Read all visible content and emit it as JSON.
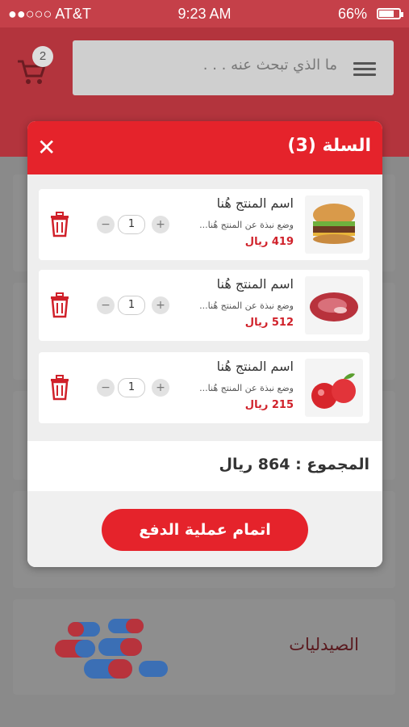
{
  "status_bar": {
    "carrier": "●●○○○ AT&T",
    "time": "9:23 AM",
    "battery": "66%"
  },
  "search": {
    "placeholder": "ما الذي تبحث عنه . . ."
  },
  "cart": {
    "count": "2"
  },
  "modal": {
    "title": "السلة (3)",
    "items": [
      {
        "name": "اسم المنتج هُنا",
        "desc": "وضع نبذة عن المنتج هُنا...",
        "price": "419 ريال",
        "qty": "1",
        "image": "burger"
      },
      {
        "name": "اسم المنتج هُنا",
        "desc": "وضع نبذة عن المنتج هُنا...",
        "price": "512 ريال",
        "qty": "1",
        "image": "meat"
      },
      {
        "name": "اسم المنتج هُنا",
        "desc": "وضع نبذة عن المنتج هُنا...",
        "price": "215 ريال",
        "qty": "1",
        "image": "apples"
      }
    ],
    "total": "المجموع : 864 ريال",
    "checkout_label": "اتمام عملية الدفع"
  },
  "background": {
    "pharmacies_label": "الصيدليات"
  },
  "colors": {
    "primary": "#e5232b",
    "header": "#b3343d"
  }
}
